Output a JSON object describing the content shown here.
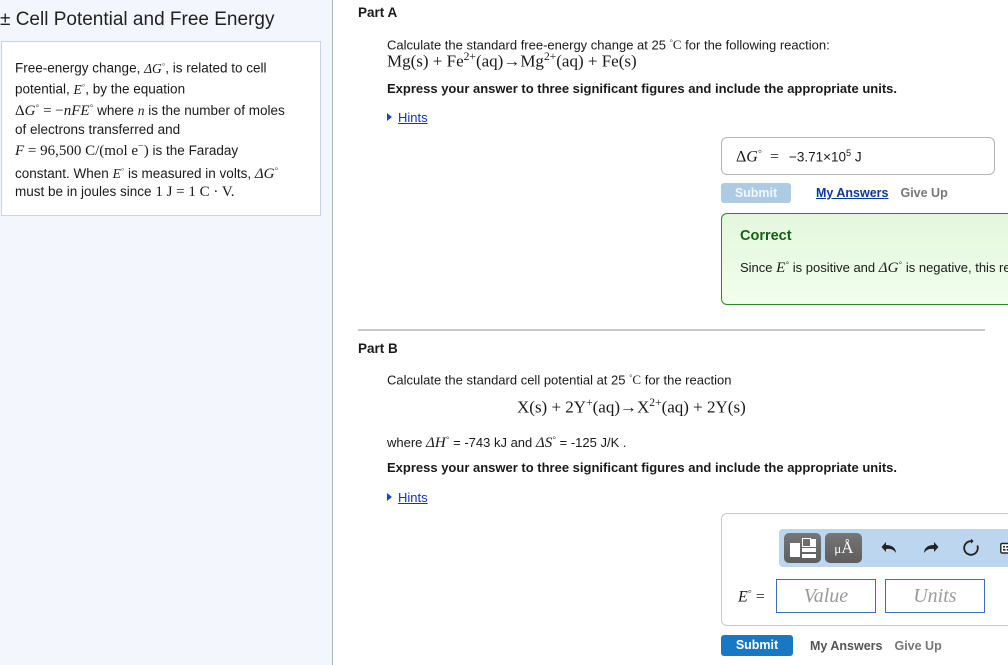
{
  "left": {
    "title": "± Cell Potential and Free Energy",
    "intro": {
      "line1_a": "Free-energy change, ",
      "line1_dg": "ΔG°",
      "line1_b": ", is related to cell",
      "line2_a": "potential, ",
      "line2_e": "E°",
      "line2_b": ", by the equation",
      "line3_eq": "ΔG° = −nFE°",
      "line3_after": " where ",
      "line3_n": "n",
      "line3_tail": " is the number of moles",
      "line4": "of electrons transferred and",
      "line5_eq": "F = 96,500 C/(mol e−)",
      "line5_after": " is the Faraday",
      "line6_a": "constant. When ",
      "line6_e": "E°",
      "line6_b": " is measured in volts, ",
      "line6_dg": "ΔG°",
      "line7_a": "must be in joules since ",
      "line7_eq": "1 J = 1 C · V."
    }
  },
  "partA": {
    "heading": "Part A",
    "prompt": "Calculate the standard free-energy change at 25 °C for the following reaction:",
    "equation": "Mg(s) + Fe2+(aq)→Mg2+(aq) + Fe(s)",
    "instruction": "Express your answer to three significant figures and include the appropriate units.",
    "hints_label": "Hints",
    "answer_label": "ΔG°  =",
    "answer_value": "−3.71×10⁵ J",
    "submit_label": "Submit",
    "my_answers_label": "My Answers",
    "give_up_label": "Give Up",
    "feedback": {
      "title": "Correct",
      "text_a": "Since ",
      "text_e": "E°",
      "text_b": " is positive and ",
      "text_dg": "ΔG°",
      "text_c": " is negative, this reaction is spontaneous under standard conditions."
    }
  },
  "partB": {
    "heading": "Part B",
    "prompt": "Calculate the standard cell potential at 25 °C for the reaction",
    "equation": "X(s) + 2Y+(aq)→X2+(aq) + 2Y(s)",
    "where_a": "where ",
    "where_dh": "ΔH°",
    "where_b": " = -743 kJ and ",
    "where_ds": "ΔS°",
    "where_c": " = -125 J/K .",
    "instruction": "Express your answer to three significant figures and include the appropriate units.",
    "hints_label": "Hints",
    "eq_label": "E°  =",
    "value_placeholder": "Value",
    "units_placeholder": "Units",
    "toolbar": {
      "template_icon": "template-icon",
      "units_icon": "μÅ",
      "undo_icon": "↶",
      "redo_icon": "↷",
      "reset_icon": "↻",
      "keyboard_icon": "⌨",
      "help_icon": "?"
    },
    "submit_label": "Submit",
    "my_answers_label": "My Answers",
    "give_up_label": "Give Up"
  },
  "colors": {
    "link": "#1532c0",
    "submit_active": "#1878c4",
    "submit_disabled": "#aecbe4",
    "correct_green": "#166016",
    "panel_bg": "#f3f7fd"
  }
}
